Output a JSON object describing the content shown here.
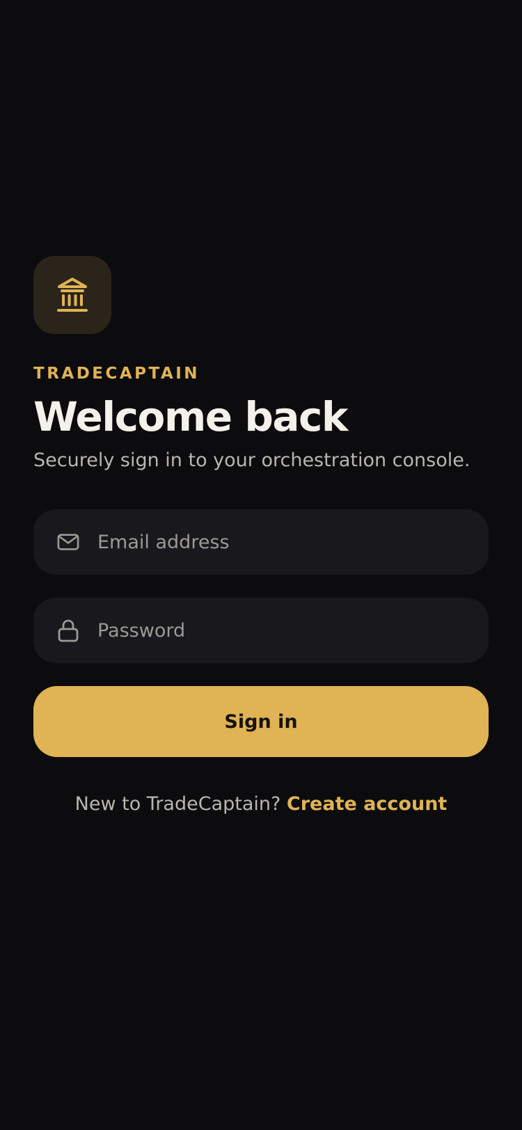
{
  "brand": {
    "name": "TRADECAPTAIN",
    "logo_icon": "bank-building-icon",
    "accent_color": "#e0b355",
    "tile_color": "#2a241a"
  },
  "header": {
    "title": "Welcome back",
    "subtitle": "Securely sign in to your orchestration console."
  },
  "form": {
    "email": {
      "icon": "mail-icon",
      "value": "",
      "placeholder": "Email address"
    },
    "password": {
      "icon": "lock-icon",
      "value": "",
      "placeholder": "Password"
    },
    "submit_label": "Sign in"
  },
  "footer": {
    "prompt": "New to TradeCaptain?",
    "link_label": "Create account"
  },
  "colors": {
    "background": "#0c0c0e",
    "field_background": "#18181d",
    "text_primary": "#f4f1ea",
    "text_secondary": "#b9b6ae"
  }
}
